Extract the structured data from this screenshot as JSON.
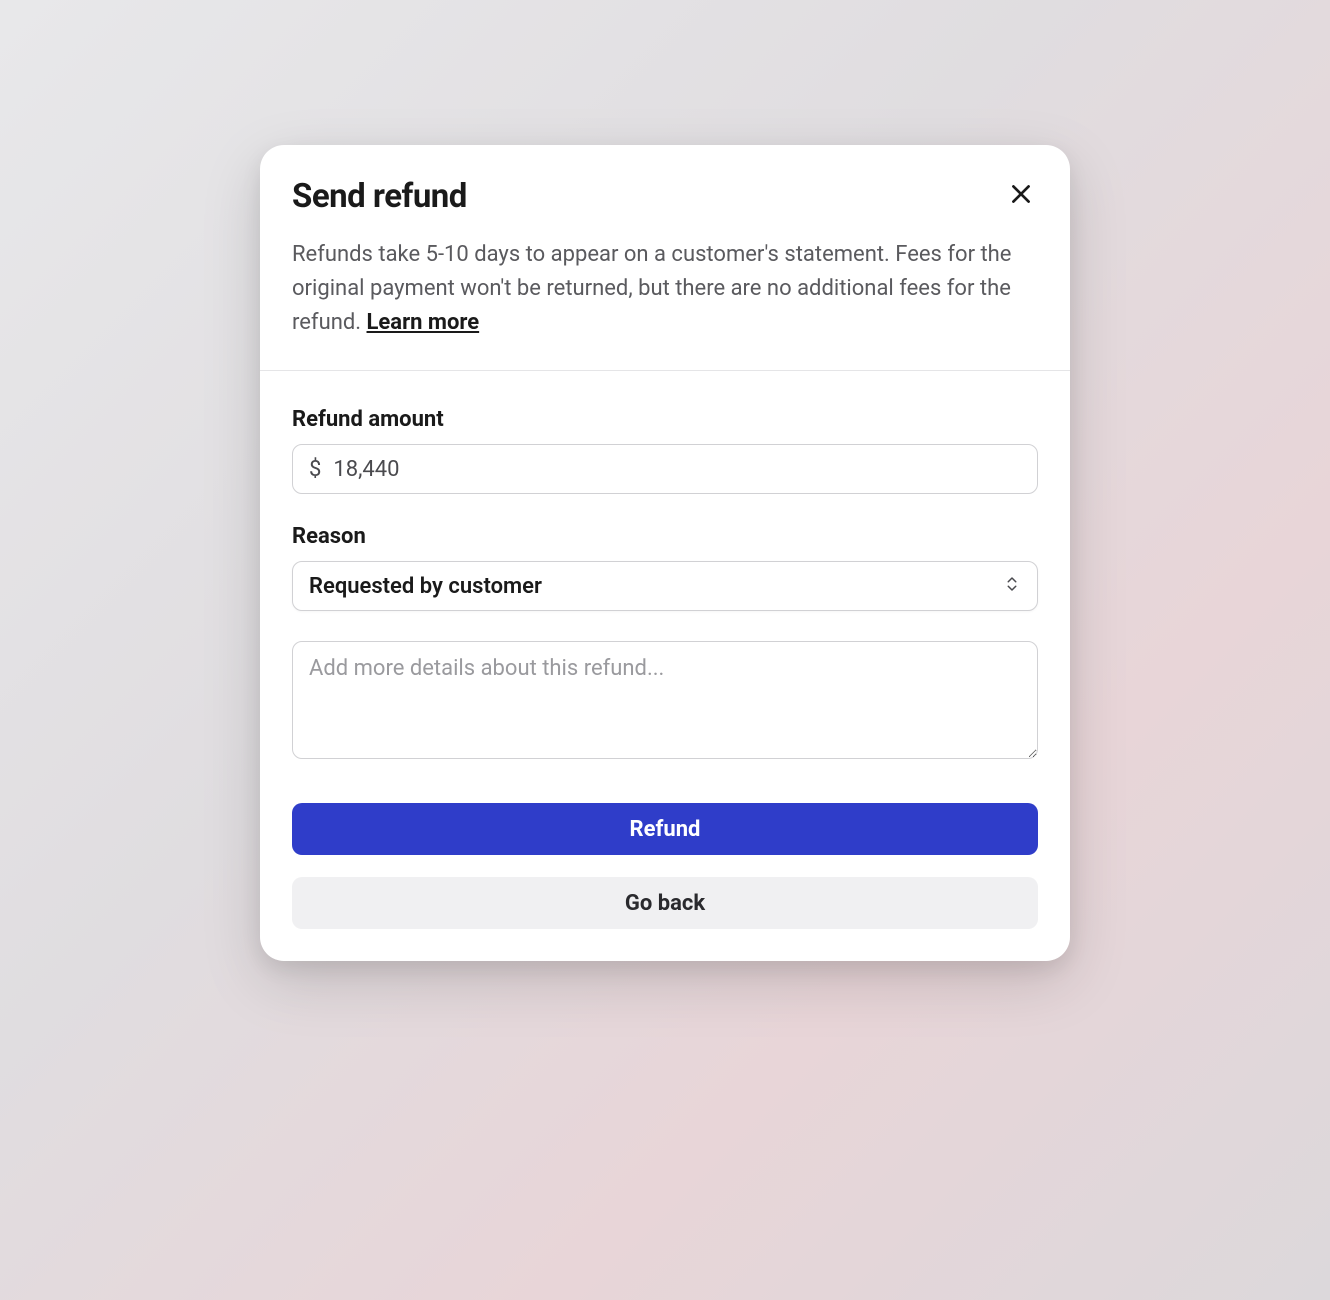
{
  "modal": {
    "title": "Send refund",
    "description_text": "Refunds take 5-10 days to appear on a customer's statement. Fees for the original payment won't be returned, but there are no additional fees for the refund. ",
    "learn_more_label": "Learn more"
  },
  "form": {
    "amount": {
      "label": "Refund amount",
      "currency_symbol": "$",
      "value": "18,440"
    },
    "reason": {
      "label": "Reason",
      "selected": "Requested by customer"
    },
    "details": {
      "placeholder": "Add more details about this refund...",
      "value": ""
    }
  },
  "buttons": {
    "primary": "Refund",
    "secondary": "Go back"
  }
}
